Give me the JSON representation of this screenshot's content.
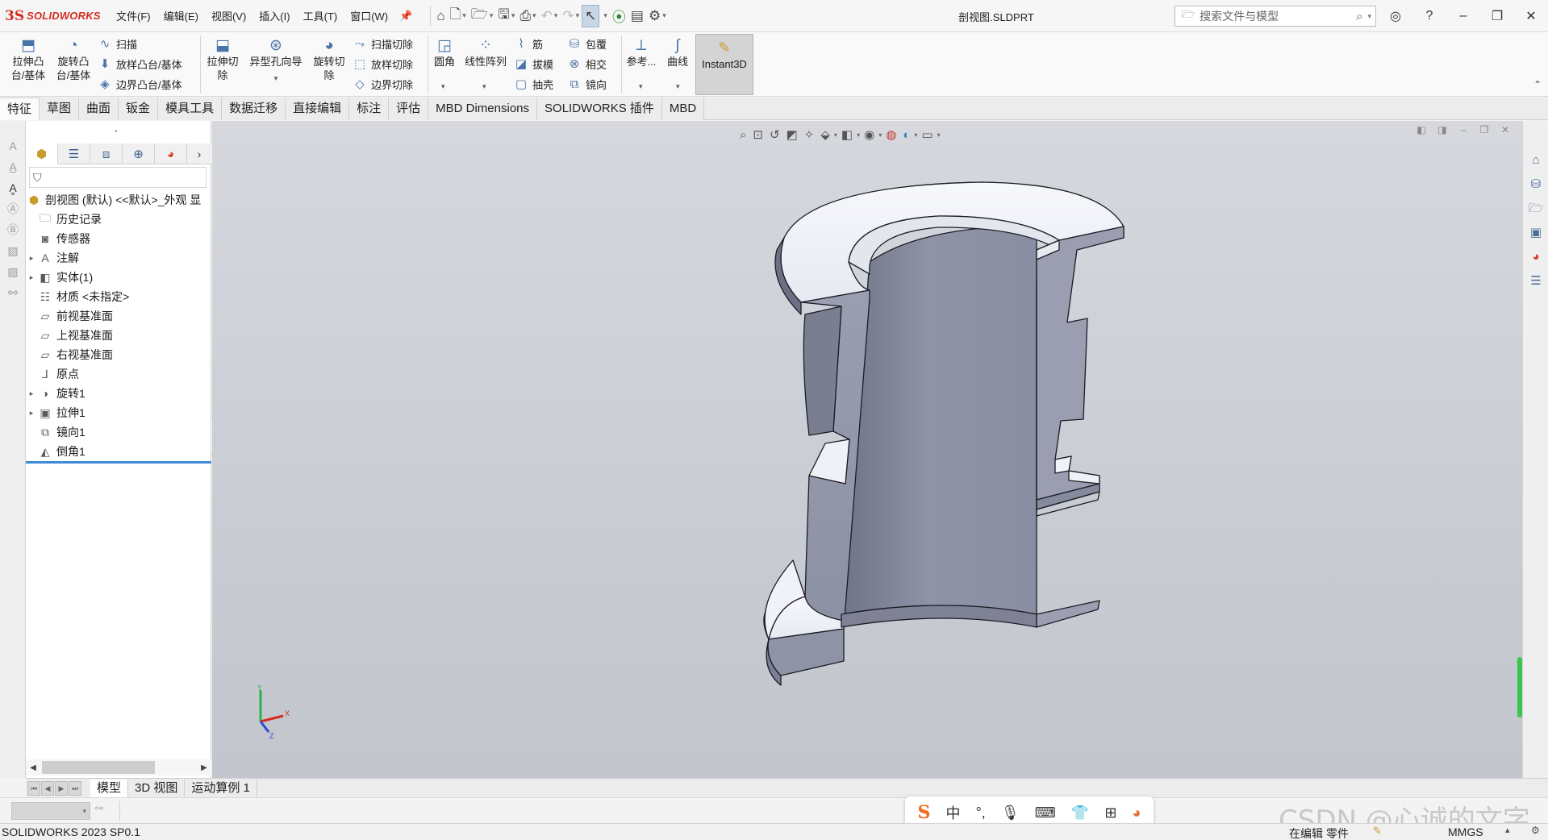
{
  "app": {
    "logo_ds": "3S",
    "logo_name": "SOLIDWORKS",
    "doc_title": "剖视图.SLDPRT"
  },
  "menus": [
    "文件(F)",
    "编辑(E)",
    "视图(V)",
    "插入(I)",
    "工具(T)",
    "窗口(W)"
  ],
  "search": {
    "placeholder": "搜索文件与模型"
  },
  "ribbon": {
    "extrude_boss": "拉伸凸\n台/基体",
    "revolve_boss": "旋转凸\n台/基体",
    "sweep": "扫描",
    "loft_boss": "放样凸台/基体",
    "boundary_boss": "边界凸台/基体",
    "extrude_cut": "拉伸切\n除",
    "hole_wizard": "异型孔向导",
    "revolve_cut": "旋转切\n除",
    "swept_cut": "扫描切除",
    "lofted_cut": "放样切除",
    "boundary_cut": "边界切除",
    "fillet": "圆角",
    "linear_pattern": "线性阵列",
    "rib": "筋",
    "draft": "拔模",
    "shell": "抽壳",
    "wrap": "包覆",
    "intersect": "相交",
    "mirror": "镜向",
    "reference": "参考...",
    "curves": "曲线",
    "instant3d": "Instant3D"
  },
  "command_tabs": [
    "特征",
    "草图",
    "曲面",
    "钣金",
    "模具工具",
    "数据迁移",
    "直接编辑",
    "标注",
    "评估",
    "MBD Dimensions",
    "SOLIDWORKS 插件",
    "MBD"
  ],
  "active_command_tab": "特征",
  "tree": {
    "root": "剖视图 (默认) <<默认>_外观 显",
    "items": [
      {
        "label": "历史记录",
        "icon": "history-icon",
        "glyph": "🗀",
        "expandable": false
      },
      {
        "label": "传感器",
        "icon": "sensor-icon",
        "glyph": "◙",
        "expandable": false
      },
      {
        "label": "注解",
        "icon": "annotations-icon",
        "glyph": "A",
        "expandable": true
      },
      {
        "label": "实体(1)",
        "icon": "solid-bodies-icon",
        "glyph": "◧",
        "expandable": true
      },
      {
        "label": "材质 <未指定>",
        "icon": "material-icon",
        "glyph": "☷",
        "expandable": false
      },
      {
        "label": "前视基准面",
        "icon": "plane-icon",
        "glyph": "▱",
        "expandable": false
      },
      {
        "label": "上视基准面",
        "icon": "plane-icon",
        "glyph": "▱",
        "expandable": false
      },
      {
        "label": "右视基准面",
        "icon": "plane-icon",
        "glyph": "▱",
        "expandable": false
      },
      {
        "label": "原点",
        "icon": "origin-icon",
        "glyph": "⅃",
        "expandable": false
      },
      {
        "label": "旋转1",
        "icon": "revolve-feature-icon",
        "glyph": "◑",
        "expandable": true
      },
      {
        "label": "拉伸1",
        "icon": "extrude-feature-icon",
        "glyph": "▣",
        "expandable": true
      },
      {
        "label": "镜向1",
        "icon": "mirror-feature-icon",
        "glyph": "⧉",
        "expandable": false
      },
      {
        "label": "倒角1",
        "icon": "chamfer-feature-icon",
        "glyph": "◭",
        "expandable": false
      }
    ]
  },
  "bottom_tabs": [
    "模型",
    "3D 视图",
    "运动算例 1"
  ],
  "active_bottom_tab": "模型",
  "status": {
    "version": "SOLIDWORKS 2023 SP0.1",
    "editing": "在编辑 零件",
    "units": "MMGS"
  },
  "ime": {
    "logo": "S",
    "mode": "中",
    "punct": "°,"
  },
  "triad": {
    "x": "X",
    "y": "Y",
    "z": "Z"
  },
  "watermark": "CSDN @心诚的文字",
  "colors": {
    "brand": "#d52b1e",
    "viewport": "#c9ccd3",
    "part_face_light": "#f2f3f8",
    "part_face_dark": "#7e8294",
    "tree_accent": "#3d8ad9"
  }
}
